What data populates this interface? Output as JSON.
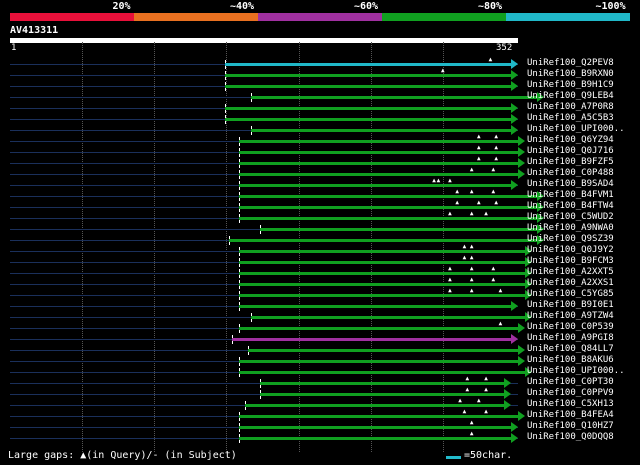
{
  "legend": {
    "labels": [
      "20%",
      "~40%",
      "~60%",
      "~80%",
      "~100%"
    ],
    "colors": [
      "#e8103a",
      "#e87020",
      "#a030a0",
      "#10a020",
      "#20b8c8"
    ]
  },
  "query": {
    "id": "AV413311",
    "length": 352,
    "start_label": "1",
    "end_label": "352"
  },
  "hits": [
    {
      "name": "UniRef100_Q2PEV8",
      "start": 149,
      "end": 352,
      "color": "cyan",
      "gaps": [
        333
      ]
    },
    {
      "name": "UniRef100_B9RXN0",
      "start": 149,
      "end": 352,
      "color": "green",
      "gaps": [
        300
      ]
    },
    {
      "name": "UniRef100_B9H1C9",
      "start": 149,
      "end": 352,
      "color": "green",
      "gaps": []
    },
    {
      "name": "UniRef100_Q9LEB4",
      "start": 167,
      "end": 370,
      "color": "green",
      "gaps": []
    },
    {
      "name": "UniRef100_A7P0R8",
      "start": 149,
      "end": 352,
      "color": "green",
      "gaps": []
    },
    {
      "name": "UniRef100_A5C5B3",
      "start": 149,
      "end": 352,
      "color": "green",
      "gaps": []
    },
    {
      "name": "UniRef100_UPI000..",
      "start": 167,
      "end": 352,
      "color": "green",
      "gaps": []
    },
    {
      "name": "UniRef100_Q6YZ94",
      "start": 159,
      "end": 357,
      "color": "green",
      "gaps": [
        325,
        337
      ]
    },
    {
      "name": "UniRef100_Q0J716",
      "start": 159,
      "end": 357,
      "color": "green",
      "gaps": [
        325,
        337
      ]
    },
    {
      "name": "UniRef100_B9FZF5",
      "start": 159,
      "end": 357,
      "color": "green",
      "gaps": [
        325,
        337
      ]
    },
    {
      "name": "UniRef100_C0P488",
      "start": 159,
      "end": 357,
      "color": "green",
      "gaps": [
        320,
        335
      ]
    },
    {
      "name": "UniRef100_B9SAD4",
      "start": 159,
      "end": 352,
      "color": "green",
      "gaps": [
        294,
        297,
        305
      ]
    },
    {
      "name": "UniRef100_B4FVM1",
      "start": 159,
      "end": 370,
      "color": "green",
      "gaps": [
        310,
        320,
        335
      ]
    },
    {
      "name": "UniRef100_B4FTW4",
      "start": 159,
      "end": 370,
      "color": "green",
      "gaps": [
        310,
        325,
        337
      ]
    },
    {
      "name": "UniRef100_C5WUD2",
      "start": 159,
      "end": 370,
      "color": "green",
      "gaps": [
        305,
        320,
        330
      ]
    },
    {
      "name": "UniRef100_A9NWA0",
      "start": 173,
      "end": 370,
      "color": "green",
      "gaps": []
    },
    {
      "name": "UniRef100_Q9SZ39",
      "start": 152,
      "end": 370,
      "color": "green",
      "gaps": []
    },
    {
      "name": "UniRef100_Q0J9Y2",
      "start": 159,
      "end": 362,
      "color": "green",
      "gaps": [
        315,
        320
      ]
    },
    {
      "name": "UniRef100_B9FCM3",
      "start": 159,
      "end": 362,
      "color": "green",
      "gaps": [
        315,
        320
      ]
    },
    {
      "name": "UniRef100_A2XXT5",
      "start": 159,
      "end": 362,
      "color": "green",
      "gaps": [
        305,
        320,
        335
      ]
    },
    {
      "name": "UniRef100_A2XXS1",
      "start": 159,
      "end": 362,
      "color": "green",
      "gaps": [
        305,
        320,
        335
      ]
    },
    {
      "name": "UniRef100_C5YG85",
      "start": 159,
      "end": 362,
      "color": "green",
      "gaps": [
        305,
        320,
        340
      ]
    },
    {
      "name": "UniRef100_B9I0E1",
      "start": 159,
      "end": 352,
      "color": "green",
      "gaps": []
    },
    {
      "name": "UniRef100_A9TZW4",
      "start": 167,
      "end": 362,
      "color": "green",
      "gaps": []
    },
    {
      "name": "UniRef100_C0P539",
      "start": 159,
      "end": 357,
      "color": "green",
      "gaps": [
        340
      ]
    },
    {
      "name": "UniRef100_A9PGI8",
      "start": 154,
      "end": 352,
      "color": "purple",
      "gaps": []
    },
    {
      "name": "UniRef100_Q84LL7",
      "start": 165,
      "end": 357,
      "color": "green",
      "gaps": []
    },
    {
      "name": "UniRef100_B8AKU6",
      "start": 159,
      "end": 357,
      "color": "green",
      "gaps": []
    },
    {
      "name": "UniRef100_UPI000..",
      "start": 159,
      "end": 362,
      "color": "green",
      "gaps": []
    },
    {
      "name": "UniRef100_C0PT30",
      "start": 173,
      "end": 347,
      "color": "green",
      "gaps": [
        317,
        330
      ]
    },
    {
      "name": "UniRef100_C0PPV9",
      "start": 173,
      "end": 347,
      "color": "green",
      "gaps": [
        317,
        330
      ]
    },
    {
      "name": "UniRef100_C5XH13",
      "start": 163,
      "end": 347,
      "color": "green",
      "gaps": [
        312,
        325
      ]
    },
    {
      "name": "UniRef100_B4FEA4",
      "start": 159,
      "end": 357,
      "color": "green",
      "gaps": [
        315,
        330
      ]
    },
    {
      "name": "UniRef100_Q10HZ7",
      "start": 159,
      "end": 352,
      "color": "green",
      "gaps": [
        320
      ]
    },
    {
      "name": "UniRef100_Q0DQQ8",
      "start": 159,
      "end": 352,
      "color": "green",
      "gaps": [
        320
      ]
    }
  ],
  "hit_colors": {
    "cyan": "#20b8c8",
    "green": "#10a020",
    "purple": "#a030a0"
  },
  "footer": {
    "text": "Large gaps: ▲(in Query)/- (in Subject)",
    "scale_label": "=50char."
  }
}
